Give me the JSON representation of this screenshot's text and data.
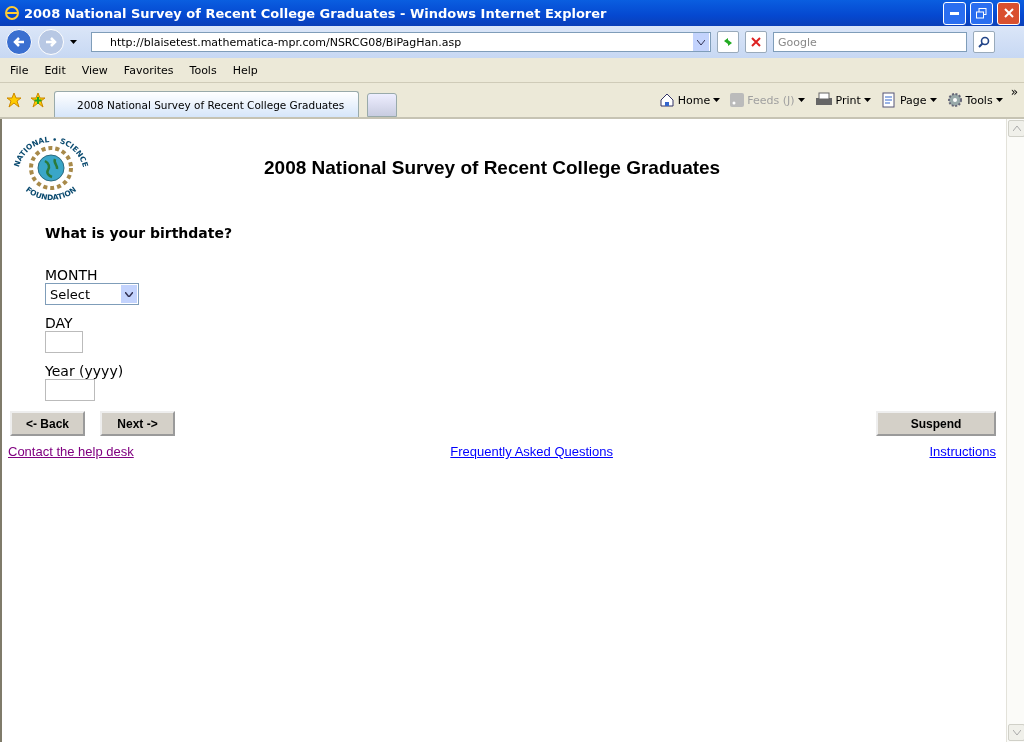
{
  "window": {
    "title": "2008 National Survey of Recent College Graduates - Windows Internet Explorer"
  },
  "address_bar": {
    "url": "http://blaisetest.mathematica-mpr.com/NSRCG08/BiPagHan.asp"
  },
  "search": {
    "placeholder": "Google"
  },
  "menu": [
    "File",
    "Edit",
    "View",
    "Favorites",
    "Tools",
    "Help"
  ],
  "tabs": [
    {
      "label": "2008 National Survey of Recent College Graduates",
      "selected": true
    }
  ],
  "command_bar": [
    {
      "kind": "home",
      "label": "Home",
      "disabled": false
    },
    {
      "kind": "feeds",
      "label": "Feeds (J)",
      "disabled": true
    },
    {
      "kind": "print",
      "label": "Print",
      "disabled": false
    },
    {
      "kind": "page",
      "label": "Page",
      "disabled": false
    },
    {
      "kind": "tools",
      "label": "Tools",
      "disabled": false
    }
  ],
  "overflow": "»",
  "logo": {
    "top_text": "NATIONAL • SCIENCE",
    "bottom_text": "FOUNDATION"
  },
  "page": {
    "heading": "2008 National Survey of Recent College Graduates",
    "question": "What is your birthdate?",
    "month": {
      "label": "MONTH",
      "value": "Select"
    },
    "day": {
      "label": "DAY"
    },
    "year": {
      "label": "Year (yyyy)"
    },
    "buttons": {
      "back": "<- Back",
      "next": "Next ->",
      "suspend": "Suspend"
    },
    "links": [
      {
        "label": "Contact the help desk",
        "visited": true
      },
      {
        "label": "Frequently Asked Questions",
        "visited": false
      },
      {
        "label": "Instructions",
        "visited": false
      }
    ]
  }
}
